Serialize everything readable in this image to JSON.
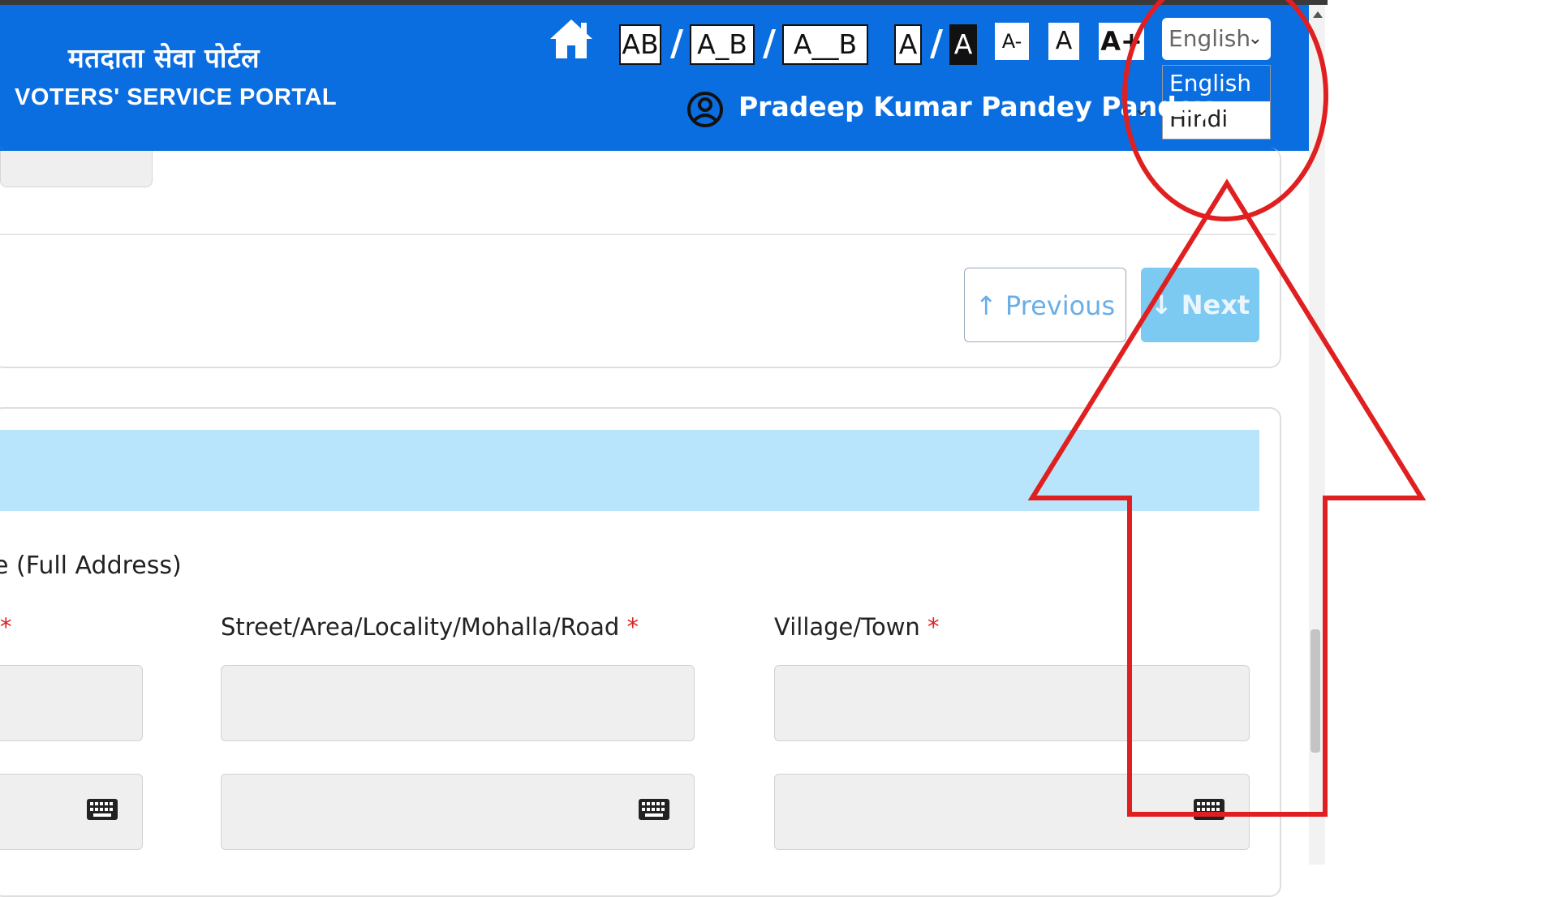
{
  "header": {
    "brand_hindi": "मतदाता सेवा पोर्टल",
    "brand_english": "VOTERS' SERVICE PORTAL",
    "spacing_controls": [
      "AB",
      "A_B",
      "A__B"
    ],
    "contrast_controls": [
      "A",
      "A"
    ],
    "font_size_controls": [
      "A-",
      "A",
      "A+"
    ],
    "language": {
      "selected": "English",
      "options": [
        "English",
        "Hindi"
      ]
    },
    "user_name": "Pradeep Kumar Pandey Pandey"
  },
  "navigation": {
    "previous_label": "Previous",
    "next_label": "Next"
  },
  "form": {
    "section_label": "e (Full Address)",
    "fields": [
      {
        "label": "",
        "required": true
      },
      {
        "label": "Street/Area/Locality/Mohalla/Road",
        "required": true
      },
      {
        "label": "Village/Town",
        "required": true
      }
    ]
  },
  "colors": {
    "header_blue": "#0a6ee0",
    "band_light_blue": "#b8e5fb",
    "next_button": "#7ccaf2",
    "annotation_red": "#e02020"
  },
  "icons": [
    "home-icon",
    "user-circle-icon",
    "chevron-down-icon",
    "keyboard-icon",
    "arrow-up-icon",
    "arrow-down-icon"
  ]
}
